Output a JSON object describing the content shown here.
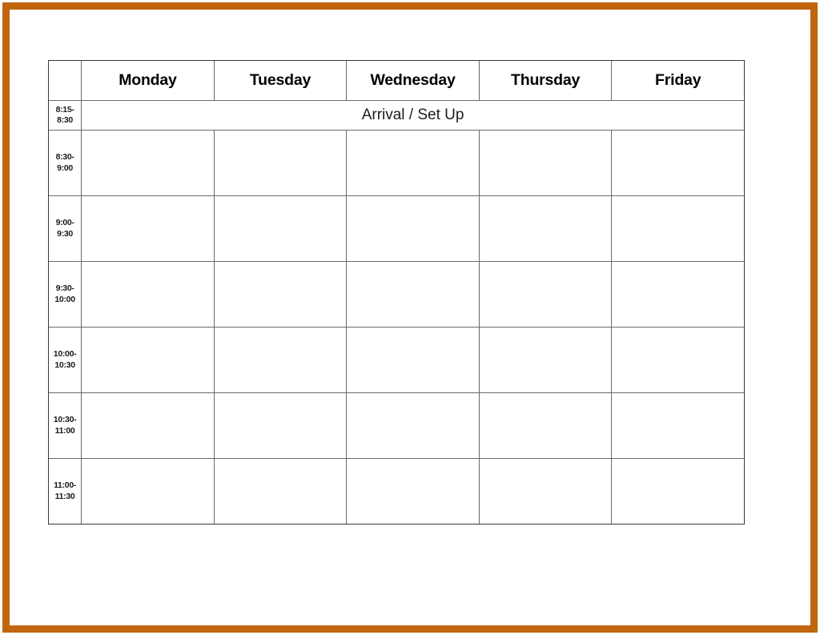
{
  "page": {
    "frame_color": "#c2650f",
    "background_color": "#ffffff",
    "grid_line_color": "#6b6b6b"
  },
  "table": {
    "corner_label": "",
    "day_headers": [
      "Monday",
      "Tuesday",
      "Wednesday",
      "Thursday",
      "Friday"
    ],
    "arrival_row": {
      "time_line1": "8:15-",
      "time_line2": "8:30",
      "label": "Arrival / Set Up"
    },
    "rows": [
      {
        "time_line1": "8:30-",
        "time_line2": "9:00",
        "cells": [
          "",
          "",
          "",
          "",
          ""
        ]
      },
      {
        "time_line1": "9:00-",
        "time_line2": "9:30",
        "cells": [
          "",
          "",
          "",
          "",
          ""
        ]
      },
      {
        "time_line1": "9:30-",
        "time_line2": "10:00",
        "cells": [
          "",
          "",
          "",
          "",
          ""
        ]
      },
      {
        "time_line1": "10:00-",
        "time_line2": "10:30",
        "cells": [
          "",
          "",
          "",
          "",
          ""
        ]
      },
      {
        "time_line1": "10:30-",
        "time_line2": "11:00",
        "cells": [
          "",
          "",
          "",
          "",
          ""
        ]
      },
      {
        "time_line1": "11:00-",
        "time_line2": "11:30",
        "cells": [
          "",
          "",
          "",
          "",
          ""
        ]
      }
    ]
  }
}
